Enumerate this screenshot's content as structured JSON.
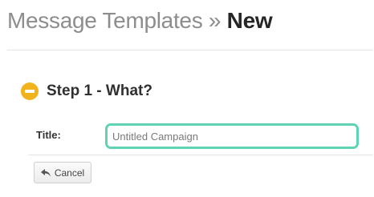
{
  "header": {
    "breadcrumb_parent": "Message Templates",
    "separator": "»",
    "current": "New"
  },
  "step": {
    "title": "Step 1 - What?",
    "icon": "minus-circle-icon",
    "icon_color": "#f2b21c"
  },
  "form": {
    "title_label": "Title:",
    "title_value": "Untitled Campaign",
    "title_focus_color": "#5fd3b4"
  },
  "actions": {
    "cancel_label": "Cancel",
    "cancel_icon": "reply-arrow-icon"
  }
}
